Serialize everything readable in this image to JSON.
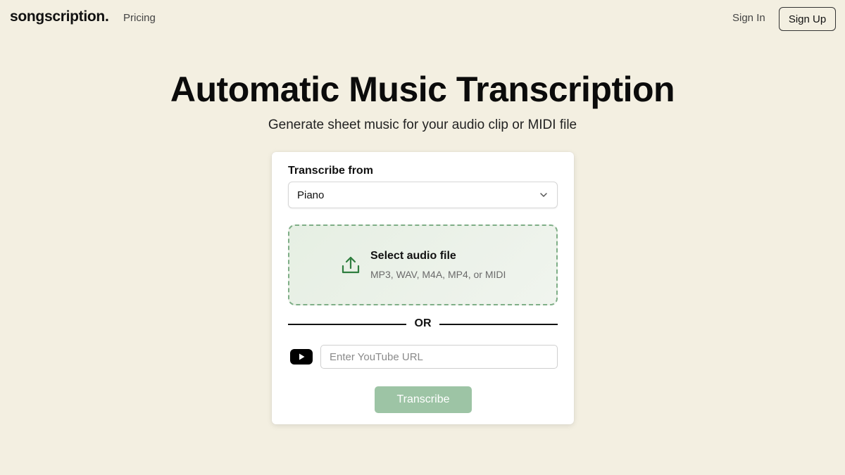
{
  "header": {
    "logo": "songscription.",
    "nav_pricing": "Pricing",
    "sign_in": "Sign In",
    "sign_up": "Sign Up"
  },
  "hero": {
    "title": "Automatic Music Transcription",
    "subtitle": "Generate sheet music for your audio clip or MIDI file"
  },
  "form": {
    "label": "Transcribe from",
    "instrument_selected": "Piano",
    "dropzone_title": "Select audio file",
    "dropzone_formats": "MP3, WAV, M4A, MP4, or MIDI",
    "or_text": "OR",
    "youtube_placeholder": "Enter YouTube URL",
    "youtube_value": "",
    "submit_label": "Transcribe"
  },
  "icons": {
    "upload": "upload-icon",
    "chevron": "chevron-down-icon",
    "youtube": "youtube-icon"
  },
  "colors": {
    "background": "#f3efe1",
    "accent_green": "#2e7d3e",
    "button_green": "#9dc4a5",
    "dropzone_border": "#7fae87"
  }
}
